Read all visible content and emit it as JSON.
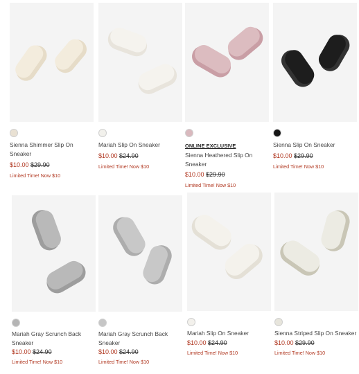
{
  "products": [
    {
      "name": "Sienna Shimmer Slip On Sneaker",
      "badge": "",
      "sale_price": "$10.00",
      "orig_price": "$29.90",
      "promo": "Limited Time! Now $10",
      "swatch_color": "#e9e1d3",
      "shoe_color": "#f3ecdd",
      "shoe_accent": "#e6dcc8"
    },
    {
      "name": "Mariah Slip On Sneaker",
      "badge": "",
      "sale_price": "$10.00",
      "orig_price": "$24.90",
      "promo": "Limited Time! Now $10",
      "swatch_color": "#f2f1ec",
      "shoe_color": "#f5f3ee",
      "shoe_accent": "#e8e4dc"
    },
    {
      "name": "Sienna Heathered Slip On Sneaker",
      "badge": "ONLINE EXCLUSIVE",
      "sale_price": "$10.00",
      "orig_price": "$29.90",
      "promo": "Limited Time! Now $10",
      "swatch_color": "#d9b9be",
      "shoe_color": "#dcbcc0",
      "shoe_accent": "#c99ea5"
    },
    {
      "name": "Sienna Slip On Sneaker",
      "badge": "",
      "sale_price": "$10.00",
      "orig_price": "$29.90",
      "promo": "Limited Time! Now $10",
      "swatch_color": "#151515",
      "shoe_color": "#1d1d1d",
      "shoe_accent": "#333333"
    },
    {
      "name": "Mariah Gray Scrunch Back Sneaker",
      "badge": "",
      "sale_price": "$10.00",
      "orig_price": "$24.90",
      "promo": "Limited Time! Now $10",
      "swatch_color": "#b5b5b5",
      "shoe_color": "#b9b9b9",
      "shoe_accent": "#9d9d9d"
    },
    {
      "name": "Mariah Gray Scrunch Back Sneaker",
      "badge": "",
      "sale_price": "$10.00",
      "orig_price": "$24.90",
      "promo": "Limited Time! Now $10",
      "swatch_color": "#c6c6c6",
      "shoe_color": "#c8c8c8",
      "shoe_accent": "#adadad"
    },
    {
      "name": "Mariah Slip On Sneaker",
      "badge": "",
      "sale_price": "$10.00",
      "orig_price": "$24.90",
      "promo": "Limited Time! Now $10",
      "swatch_color": "#f3f1ec",
      "shoe_color": "#f4f2ec",
      "shoe_accent": "#e4e0d6"
    },
    {
      "name": "Sienna Striped Slip On Sneaker",
      "badge": "",
      "sale_price": "$10.00",
      "orig_price": "$29.90",
      "promo": "Limited Time! Now $10",
      "swatch_color": "#e7e5dc",
      "shoe_color": "#ecebe3",
      "shoe_accent": "#c9c6b6"
    }
  ]
}
